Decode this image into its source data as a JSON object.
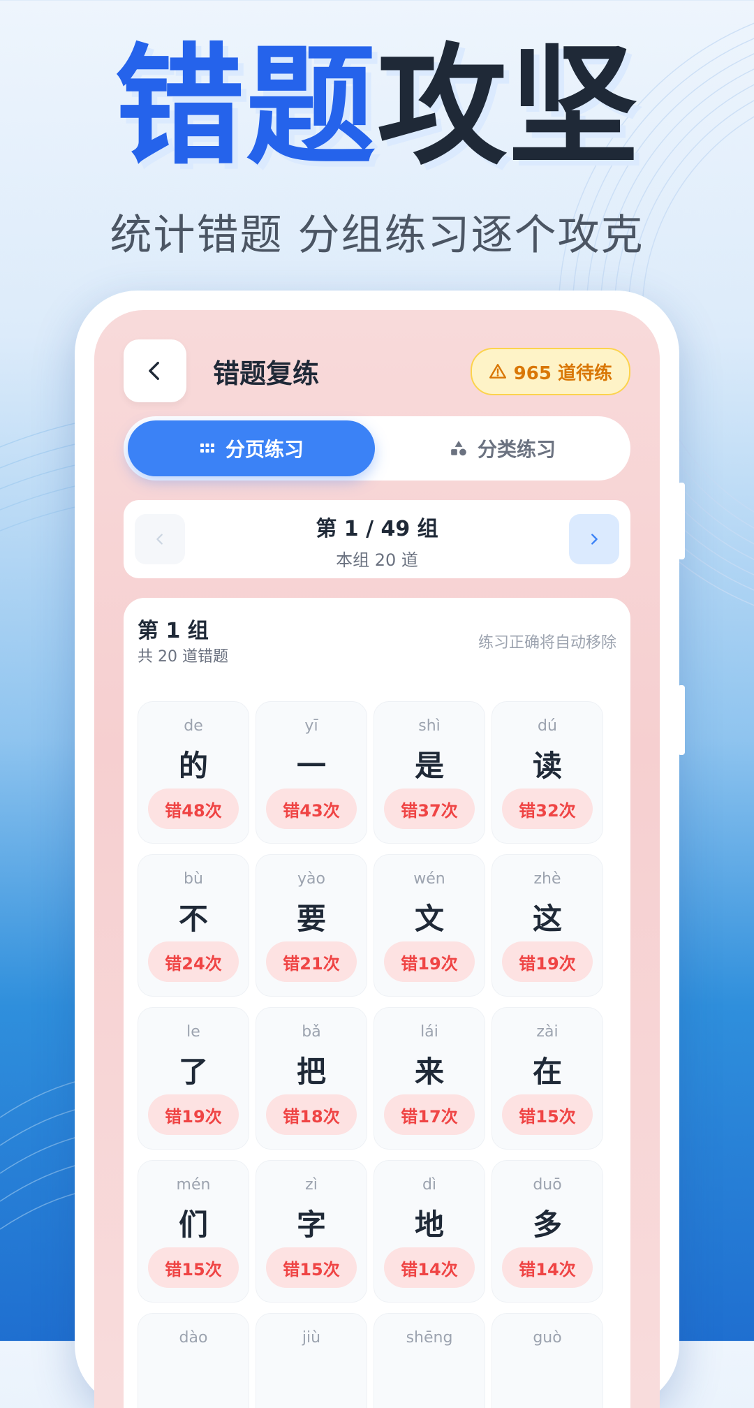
{
  "promo": {
    "headline_blue": "错题",
    "headline_dark": "攻坚",
    "subheadline": "统计错题 分组练习逐个攻克"
  },
  "header": {
    "title": "错题复练",
    "pending_badge": "965 道待练"
  },
  "tabs": [
    {
      "label": "分页练习",
      "active": true,
      "icon": "grid-icon"
    },
    {
      "label": "分类练习",
      "active": false,
      "icon": "shapes-icon"
    }
  ],
  "pager": {
    "title": "第 1 / 49 组",
    "subtitle": "本组 20 道"
  },
  "group": {
    "title": "第 1 组",
    "subtitle": "共 20 道错题",
    "note": "练习正确将自动移除"
  },
  "items": [
    {
      "pinyin": "de",
      "char": "的",
      "errors": "错48次"
    },
    {
      "pinyin": "yī",
      "char": "一",
      "errors": "错43次"
    },
    {
      "pinyin": "shì",
      "char": "是",
      "errors": "错37次"
    },
    {
      "pinyin": "dú",
      "char": "读",
      "errors": "错32次"
    },
    {
      "pinyin": "bù",
      "char": "不",
      "errors": "错24次"
    },
    {
      "pinyin": "yào",
      "char": "要",
      "errors": "错21次"
    },
    {
      "pinyin": "wén",
      "char": "文",
      "errors": "错19次"
    },
    {
      "pinyin": "zhè",
      "char": "这",
      "errors": "错19次"
    },
    {
      "pinyin": "le",
      "char": "了",
      "errors": "错19次"
    },
    {
      "pinyin": "bǎ",
      "char": "把",
      "errors": "错18次"
    },
    {
      "pinyin": "lái",
      "char": "来",
      "errors": "错17次"
    },
    {
      "pinyin": "zài",
      "char": "在",
      "errors": "错15次"
    },
    {
      "pinyin": "mén",
      "char": "们",
      "errors": "错15次"
    },
    {
      "pinyin": "zì",
      "char": "字",
      "errors": "错15次"
    },
    {
      "pinyin": "dì",
      "char": "地",
      "errors": "错14次"
    },
    {
      "pinyin": "duō",
      "char": "多",
      "errors": "错14次"
    },
    {
      "pinyin": "dào",
      "char": "",
      "errors": ""
    },
    {
      "pinyin": "jiù",
      "char": "",
      "errors": ""
    },
    {
      "pinyin": "shēng",
      "char": "",
      "errors": ""
    },
    {
      "pinyin": "guò",
      "char": "",
      "errors": ""
    }
  ],
  "colors": {
    "accent": "#3b82f6",
    "error": "#ef4444",
    "warning": "#d97706"
  }
}
